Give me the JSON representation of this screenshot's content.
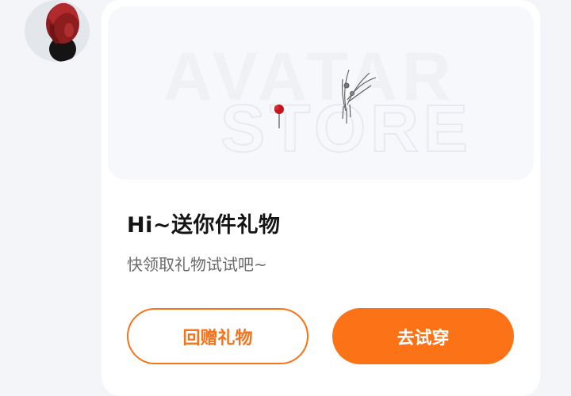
{
  "hero": {
    "watermark_line1": "AVATAR",
    "watermark_line2": "STORE"
  },
  "card": {
    "title": "Hi~送你件礼物",
    "subtitle": "快领取礼物试试吧~"
  },
  "buttons": {
    "return_gift": "回赠礼物",
    "try_on": "去试穿"
  },
  "colors": {
    "accent": "#fc7216",
    "outline": "#f5731a",
    "background": "#f3f5f8"
  }
}
